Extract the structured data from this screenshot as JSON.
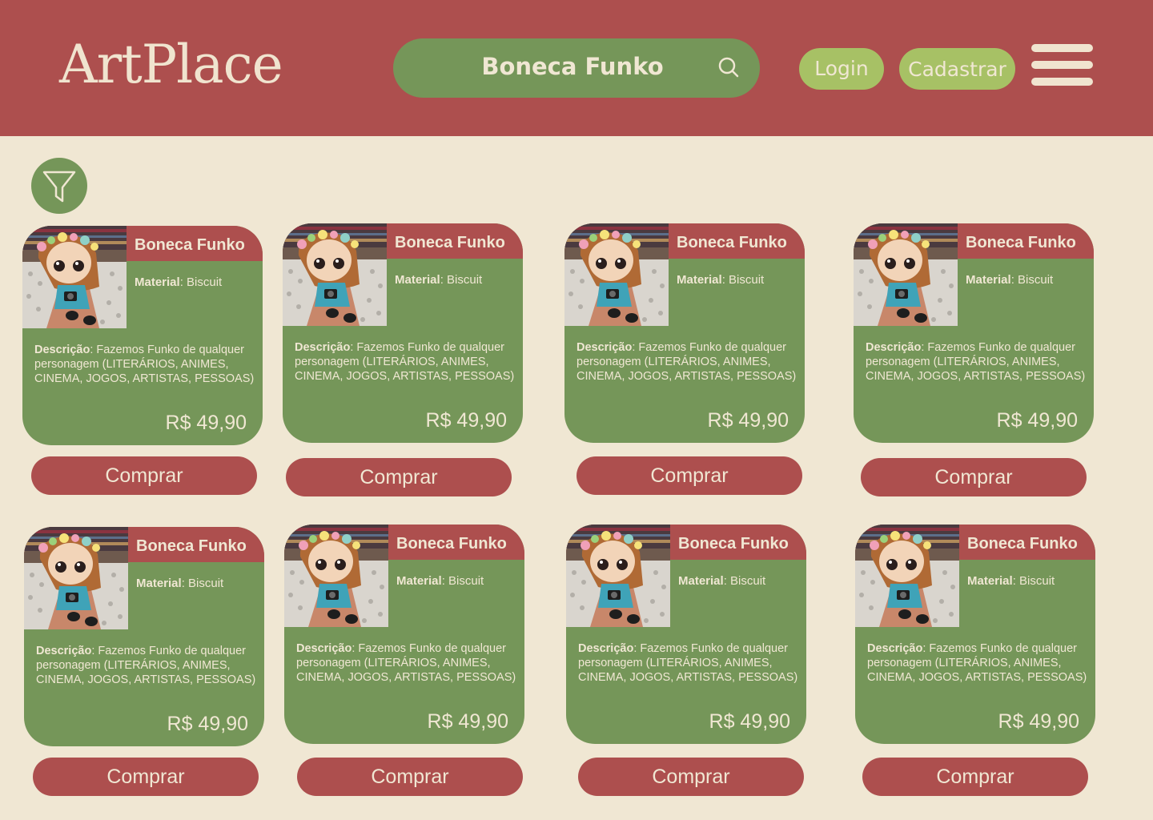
{
  "header": {
    "logo": "ArtPlace",
    "search_value": "Boneca Funko",
    "login_label": "Login",
    "signup_label": "Cadastrar"
  },
  "colors": {
    "header_bg": "#AD4F4E",
    "page_bg": "#F0E7D3",
    "card_green": "#759659",
    "pill_green": "#A7C165",
    "accent_red": "#AD4F4E"
  },
  "icons": {
    "search": "search-icon",
    "menu": "hamburger-menu-icon",
    "filter": "filter-funnel-icon"
  },
  "products": [
    {
      "title": "Boneca Funko",
      "material_label": "Material",
      "material": "Biscuit",
      "description_label": "Descrição",
      "description": "Fazemos Funko de qualquer personagem (LITERÁRIOS, ANIMES, CINEMA, JOGOS, ARTISTAS, PESSOAS)",
      "price": "R$ 49,90",
      "buy_label": "Comprar"
    },
    {
      "title": "Boneca Funko",
      "material_label": "Material",
      "material": "Biscuit",
      "description_label": "Descrição",
      "description": "Fazemos Funko de qualquer personagem (LITERÁRIOS, ANIMES, CINEMA, JOGOS, ARTISTAS, PESSOAS)",
      "price": "R$ 49,90",
      "buy_label": "Comprar"
    },
    {
      "title": "Boneca Funko",
      "material_label": "Material",
      "material": "Biscuit",
      "description_label": "Descrição",
      "description": "Fazemos Funko de qualquer personagem (LITERÁRIOS, ANIMES, CINEMA, JOGOS, ARTISTAS, PESSOAS)",
      "price": "R$ 49,90",
      "buy_label": "Comprar"
    },
    {
      "title": "Boneca Funko",
      "material_label": "Material",
      "material": "Biscuit",
      "description_label": "Descrição",
      "description": "Fazemos Funko de qualquer personagem (LITERÁRIOS, ANIMES, CINEMA, JOGOS, ARTISTAS, PESSOAS)",
      "price": "R$ 49,90",
      "buy_label": "Comprar"
    },
    {
      "title": "Boneca Funko",
      "material_label": "Material",
      "material": "Biscuit",
      "description_label": "Descrição",
      "description": "Fazemos Funko de qualquer personagem (LITERÁRIOS, ANIMES, CINEMA, JOGOS, ARTISTAS, PESSOAS)",
      "price": "R$ 49,90",
      "buy_label": "Comprar"
    },
    {
      "title": "Boneca Funko",
      "material_label": "Material",
      "material": "Biscuit",
      "description_label": "Descrição",
      "description": "Fazemos Funko de qualquer personagem (LITERÁRIOS, ANIMES, CINEMA, JOGOS, ARTISTAS, PESSOAS)",
      "price": "R$ 49,90",
      "buy_label": "Comprar"
    },
    {
      "title": "Boneca Funko",
      "material_label": "Material",
      "material": "Biscuit",
      "description_label": "Descrição",
      "description": "Fazemos Funko de qualquer personagem (LITERÁRIOS, ANIMES, CINEMA, JOGOS, ARTISTAS, PESSOAS)",
      "price": "R$ 49,90",
      "buy_label": "Comprar"
    },
    {
      "title": "Boneca Funko",
      "material_label": "Material",
      "material": "Biscuit",
      "description_label": "Descrição",
      "description": "Fazemos Funko de qualquer personagem (LITERÁRIOS, ANIMES, CINEMA, JOGOS, ARTISTAS, PESSOAS)",
      "price": "R$ 49,90",
      "buy_label": "Comprar"
    }
  ]
}
